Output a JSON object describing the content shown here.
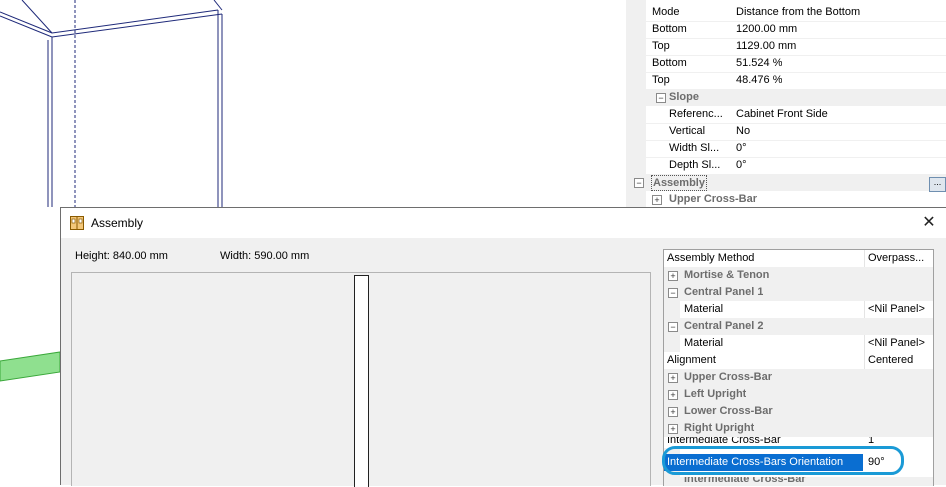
{
  "property_grid": {
    "rows": [
      {
        "name": "Mode",
        "value": "Distance from the Bottom"
      },
      {
        "name": "Bottom",
        "value": "1200.00 mm"
      },
      {
        "name": "Top",
        "value": "1129.00 mm"
      },
      {
        "name": "Bottom",
        "value": "51.524 %"
      },
      {
        "name": "Top",
        "value": "48.476 %"
      }
    ],
    "slope_category": "Slope",
    "slope_rows": [
      {
        "name": "Referenc...",
        "value": "Cabinet Front Side"
      },
      {
        "name": "Vertical",
        "value": "No"
      },
      {
        "name": "Width Sl...",
        "value": "0°"
      },
      {
        "name": "Depth Sl...",
        "value": "0°"
      }
    ],
    "assembly_category": "Assembly",
    "assembly_button": "...",
    "upper_cross_bar": "Upper Cross-Bar"
  },
  "dialog": {
    "title": "Assembly",
    "close_glyph": "✕",
    "height_label": "Height: 840.00 mm",
    "width_label": "Width: 590.00 mm",
    "properties": {
      "assembly_method": {
        "name": "Assembly Method",
        "value": "Overpass..."
      },
      "mortise": "Mortise & Tenon",
      "central_panel_1": "Central Panel 1",
      "material_1": {
        "name": "Material",
        "value": "<Nil Panel>"
      },
      "central_panel_2": "Central Panel 2",
      "material_2": {
        "name": "Material",
        "value": "<Nil Panel>"
      },
      "alignment": {
        "name": "Alignment",
        "value": "Centered"
      },
      "upper_cross_bar": "Upper Cross-Bar",
      "left_upright": "Left Upright",
      "lower_cross_bar": "Lower Cross-Bar",
      "right_upright": "Right Upright",
      "intermediate_cross_bar": {
        "name": "Intermediate Cross-Bar",
        "value": "1"
      },
      "intermediate_orientation": {
        "name": "Intermediate Cross-Bars Orientation",
        "value": "90°"
      },
      "intermediate_cross_bar_cat": "Intermediate Cross-Bar"
    }
  },
  "colors": {
    "selection": "#0a6ed1",
    "highlight": "#1a9ad6",
    "green_bar": "#7bd17b",
    "model_lines": "#1f2a7a"
  }
}
